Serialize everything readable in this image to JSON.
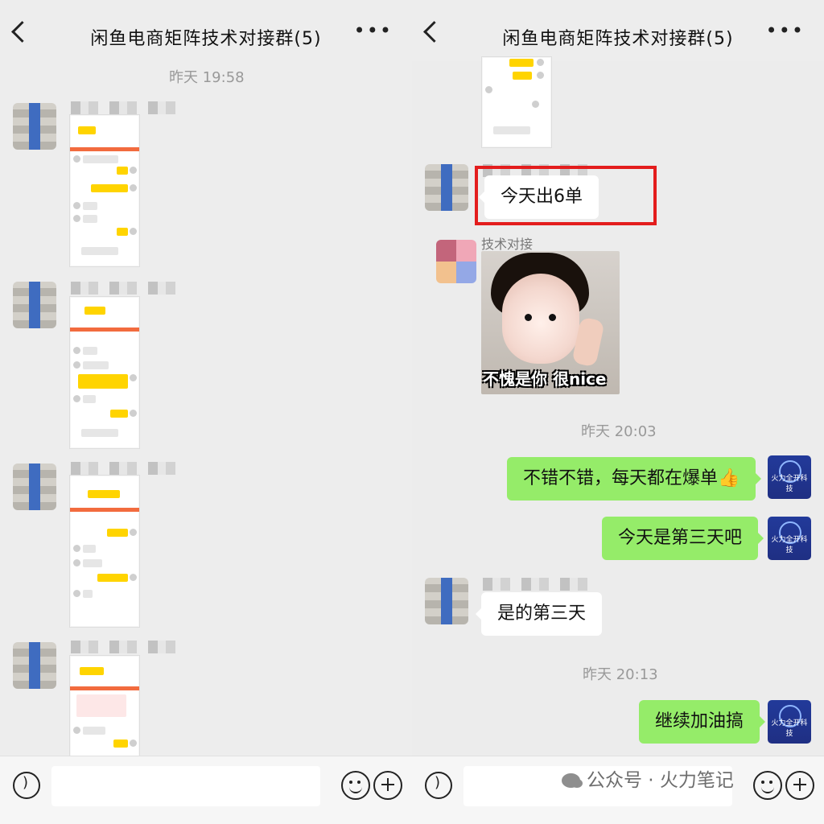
{
  "header": {
    "title": "闲鱼电商矩阵技术对接群(5)"
  },
  "left": {
    "timestamp": "昨天 19:58"
  },
  "right": {
    "sender_tag": "技术对接",
    "msg_1": "今天出6单",
    "sticker_caption": "不愧是你 很nice",
    "time_1": "昨天 20:03",
    "reply_1": "不错不错，每天都在爆单👍",
    "reply_2": "今天是第三天吧",
    "msg_2": "是的第三天",
    "time_2": "昨天 20:13",
    "reply_3": "继续加油搞",
    "avatar_label": "火力全开科技"
  },
  "watermark": {
    "text": "公众号 · 火力笔记"
  },
  "colors": {
    "green_bubble": "#95ec69",
    "highlight_box": "#e31d1d"
  },
  "icons": {
    "back": "chevron-left-icon",
    "more": "more-icon",
    "voice": "voice-icon",
    "emoji": "emoji-icon",
    "plus": "plus-icon"
  }
}
